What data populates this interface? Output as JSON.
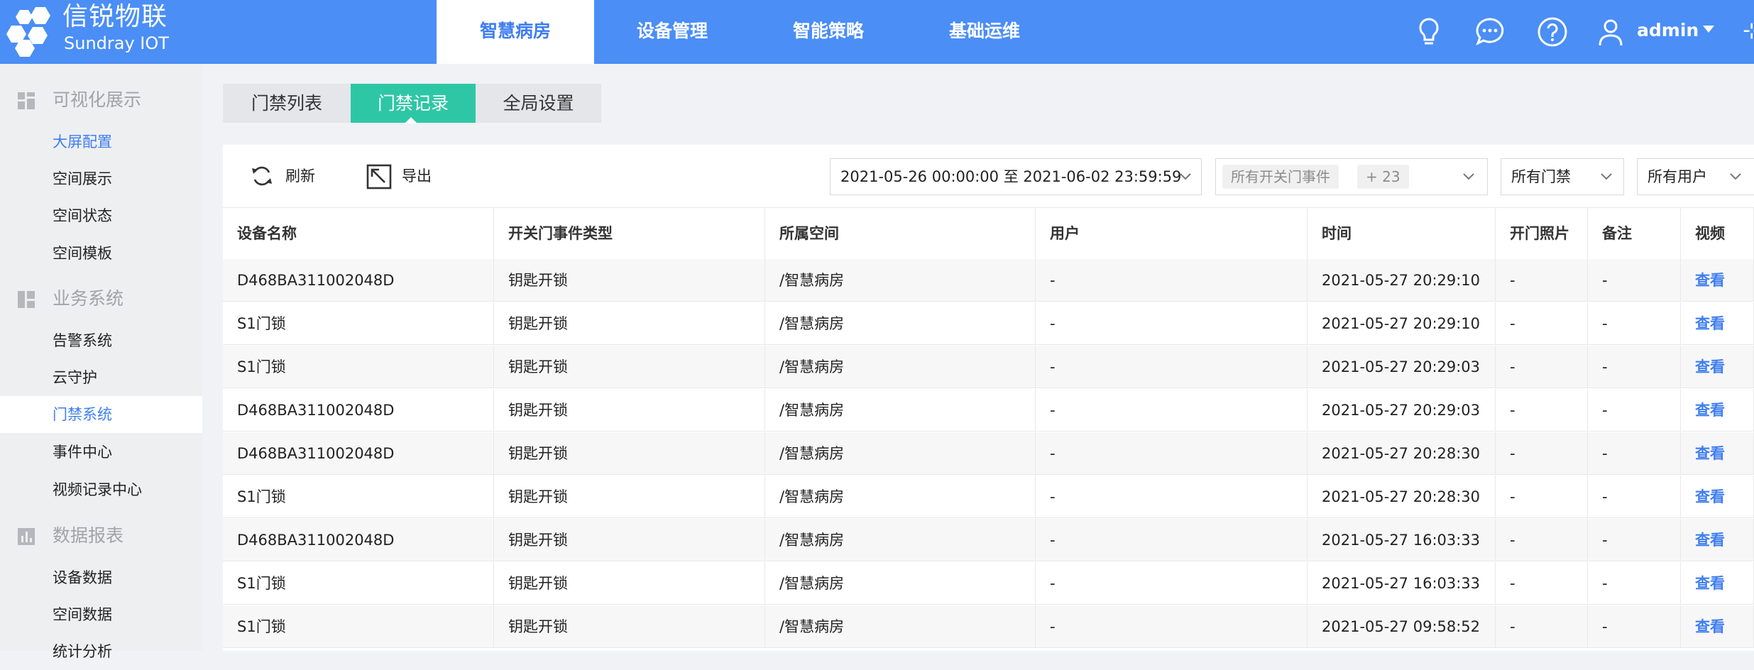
{
  "brand": {
    "name_cn": "信锐物联",
    "name_en": "Sundray IOT"
  },
  "colors": {
    "topbar": "#4a8ef6",
    "accent": "#3f7ef0",
    "active_subtab": "#2ec7a6"
  },
  "top_nav": [
    {
      "label": "智慧病房",
      "active": true
    },
    {
      "label": "设备管理",
      "active": false
    },
    {
      "label": "智能策略",
      "active": false
    },
    {
      "label": "基础运维",
      "active": false
    }
  ],
  "top_icons": [
    "lightbulb-icon",
    "chat-icon",
    "help-icon",
    "user-icon"
  ],
  "user": {
    "name": "admin"
  },
  "sidebar": {
    "groups": [
      {
        "icon": "dashboard-icon",
        "label": "可视化展示",
        "items": [
          {
            "label": "大屏配置"
          },
          {
            "label": "空间展示"
          },
          {
            "label": "空间状态"
          },
          {
            "label": "空间模板"
          }
        ]
      },
      {
        "icon": "business-icon",
        "label": "业务系统",
        "items": [
          {
            "label": "告警系统"
          },
          {
            "label": "云守护"
          },
          {
            "label": "门禁系统"
          },
          {
            "label": "事件中心"
          },
          {
            "label": "视频记录中心"
          }
        ]
      },
      {
        "icon": "report-icon",
        "label": "数据报表",
        "items": [
          {
            "label": "设备数据"
          },
          {
            "label": "空间数据"
          },
          {
            "label": "统计分析"
          }
        ]
      }
    ],
    "active_item": "门禁系统",
    "highlighted_item": "大屏配置"
  },
  "sub_tabs": [
    {
      "label": "门禁列表",
      "active": false
    },
    {
      "label": "门禁记录",
      "active": true
    },
    {
      "label": "全局设置",
      "active": false
    }
  ],
  "toolbar": {
    "refresh_label": "刷新",
    "export_label": "导出"
  },
  "filters": {
    "date_range": "2021-05-26 00:00:00 至 2021-06-02 23:59:59",
    "event_type_tag": "所有开关门事件",
    "event_type_more": "+ 23",
    "door_select": "所有门禁",
    "user_select": "所有用户"
  },
  "table": {
    "columns": [
      "设备名称",
      "开关门事件类型",
      "所属空间",
      "用户",
      "时间",
      "开门照片",
      "备注",
      "视频"
    ],
    "rows": [
      [
        "D468BA311002048D",
        "钥匙开锁",
        "/智慧病房",
        "-",
        "2021-05-27 20:29:10",
        "-",
        "-",
        "查看"
      ],
      [
        "S1门锁",
        "钥匙开锁",
        "/智慧病房",
        "-",
        "2021-05-27 20:29:10",
        "-",
        "-",
        "查看"
      ],
      [
        "S1门锁",
        "钥匙开锁",
        "/智慧病房",
        "-",
        "2021-05-27 20:29:03",
        "-",
        "-",
        "查看"
      ],
      [
        "D468BA311002048D",
        "钥匙开锁",
        "/智慧病房",
        "-",
        "2021-05-27 20:29:03",
        "-",
        "-",
        "查看"
      ],
      [
        "D468BA311002048D",
        "钥匙开锁",
        "/智慧病房",
        "-",
        "2021-05-27 20:28:30",
        "-",
        "-",
        "查看"
      ],
      [
        "S1门锁",
        "钥匙开锁",
        "/智慧病房",
        "-",
        "2021-05-27 20:28:30",
        "-",
        "-",
        "查看"
      ],
      [
        "D468BA311002048D",
        "钥匙开锁",
        "/智慧病房",
        "-",
        "2021-05-27 16:03:33",
        "-",
        "-",
        "查看"
      ],
      [
        "S1门锁",
        "钥匙开锁",
        "/智慧病房",
        "-",
        "2021-05-27 16:03:33",
        "-",
        "-",
        "查看"
      ],
      [
        "S1门锁",
        "钥匙开锁",
        "/智慧病房",
        "-",
        "2021-05-27 09:58:52",
        "-",
        "-",
        "查看"
      ]
    ]
  }
}
